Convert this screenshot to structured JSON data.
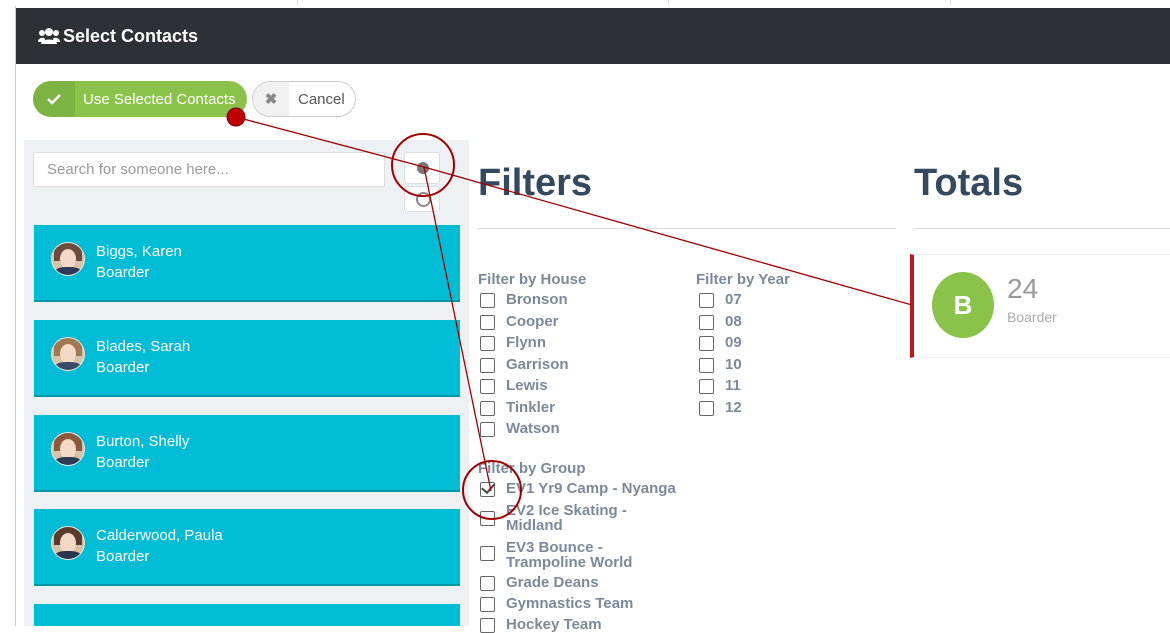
{
  "dialog": {
    "title": "Select Contacts"
  },
  "actions": {
    "use_label": "Use Selected Contacts",
    "cancel_label": "Cancel"
  },
  "search": {
    "placeholder": "Search for someone here..."
  },
  "contacts": [
    {
      "name": "Biggs, Karen",
      "role": "Boarder"
    },
    {
      "name": "Blades, Sarah",
      "role": "Boarder"
    },
    {
      "name": "Burton, Shelly",
      "role": "Boarder"
    },
    {
      "name": "Calderwood, Paula",
      "role": "Boarder"
    }
  ],
  "filters": {
    "title": "Filters",
    "house": {
      "title": "Filter by House",
      "items": [
        "Bronson",
        "Cooper",
        "Flynn",
        "Garrison",
        "Lewis",
        "Tinkler",
        "Watson"
      ]
    },
    "year": {
      "title": "Filter by Year",
      "items": [
        "07",
        "08",
        "09",
        "10",
        "11",
        "12"
      ]
    },
    "group": {
      "title": "Filter by Group",
      "items": [
        {
          "line1": "EV1 Yr9 Camp - Nyanga",
          "line2": "",
          "checked": true
        },
        {
          "line1": "EV2 Ice Skating -",
          "line2": "Midland",
          "checked": false
        },
        {
          "line1": "EV3 Bounce -",
          "line2": "Trampoline World",
          "checked": false
        },
        {
          "line1": "Grade Deans",
          "line2": "",
          "checked": false
        },
        {
          "line1": "Gymnastics Team",
          "line2": "",
          "checked": false
        },
        {
          "line1": "Hockey Team",
          "line2": "",
          "checked": false
        }
      ]
    }
  },
  "totals": {
    "title": "Totals",
    "items": [
      {
        "initial": "B",
        "count": "24",
        "label": "Boarder"
      }
    ]
  },
  "colors": {
    "header_bg": "#2d3035",
    "primary_green": "#8bc34a",
    "card_cyan": "#00bcd4",
    "heading": "#34495e",
    "annotation_red": "#a00000"
  }
}
